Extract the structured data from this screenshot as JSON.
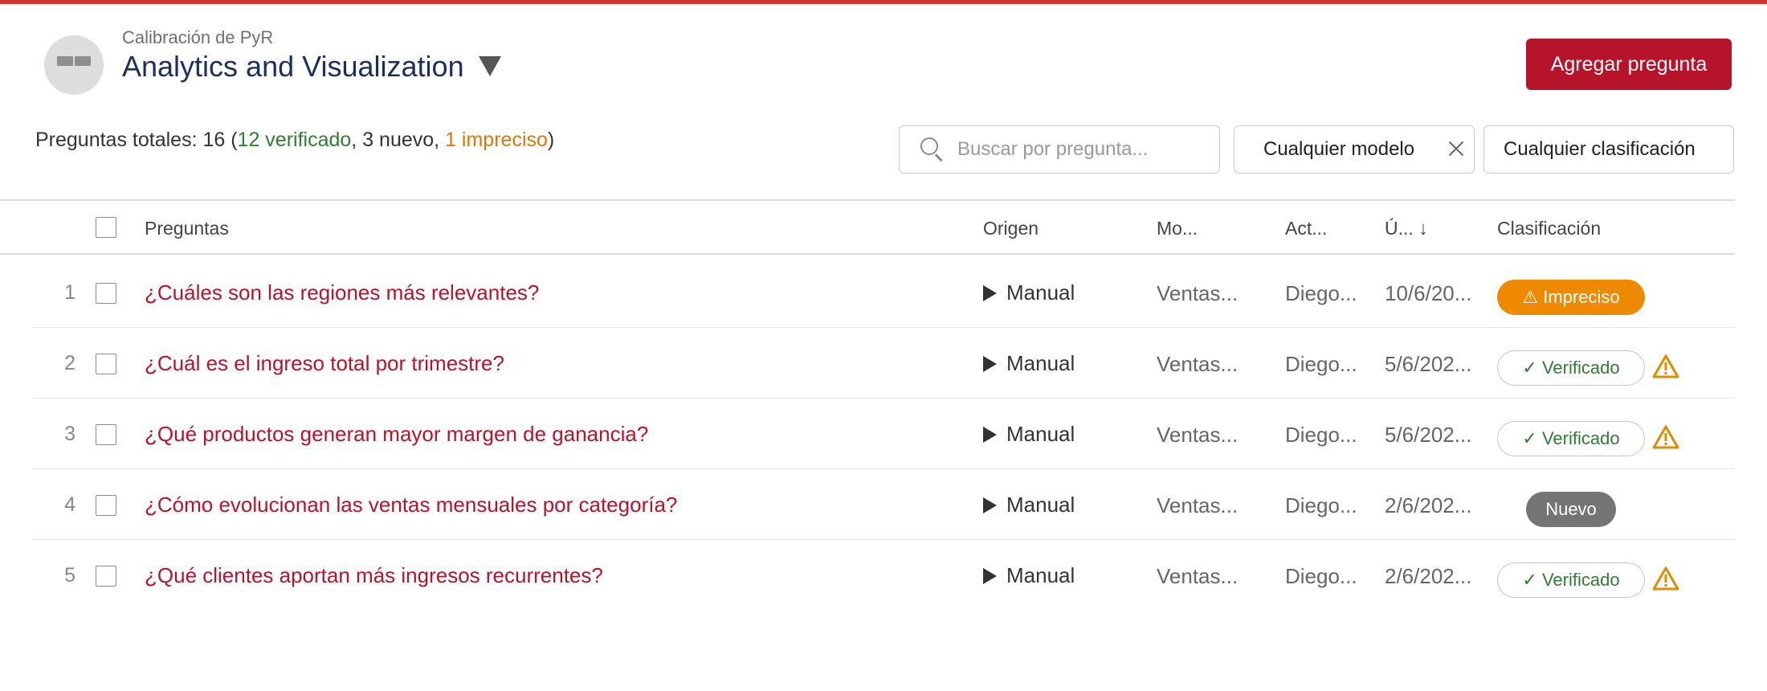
{
  "header": {
    "subtitle": "Calibración de PyR",
    "title": "Analytics and Visualization",
    "add_button": "Agregar pregunta"
  },
  "summary": {
    "prefix": "Preguntas totales: 16 (",
    "verified": "12 verificado",
    "sep1": ", ",
    "new": "3 nuevo",
    "sep2": ", ",
    "imprecise": "1 impreciso",
    "suffix": ")"
  },
  "filters": {
    "search_placeholder": "Buscar por pregunta...",
    "model": "Cualquier modelo",
    "classification": "Cualquier clasificación"
  },
  "columns": {
    "questions": "Preguntas",
    "origin": "Origen",
    "model": "Mo...",
    "actor": "Act...",
    "last": "Ú...",
    "sort_arrow": "↓",
    "classification": "Clasificación"
  },
  "rows": [
    {
      "num": "1",
      "question": "¿Cuáles son las regiones más relevantes?",
      "origin": "Manual",
      "model": "Ventas...",
      "actor": "Diego...",
      "date": "10/6/20...",
      "badge": "⚠ Impreciso",
      "status": "impreciso",
      "warning": false
    },
    {
      "num": "2",
      "question": "¿Cuál es el ingreso total por trimestre?",
      "origin": "Manual",
      "model": "Ventas...",
      "actor": "Diego...",
      "date": "5/6/202...",
      "badge": "✓ Verificado",
      "status": "verificado",
      "warning": true
    },
    {
      "num": "3",
      "question": "¿Qué productos generan mayor margen de ganancia?",
      "origin": "Manual",
      "model": "Ventas...",
      "actor": "Diego...",
      "date": "5/6/202...",
      "badge": "✓ Verificado",
      "status": "verificado",
      "warning": true
    },
    {
      "num": "4",
      "question": "¿Cómo evolucionan las ventas mensuales por categoría?",
      "origin": "Manual",
      "model": "Ventas...",
      "actor": "Diego...",
      "date": "2/6/202...",
      "badge": "Nuevo",
      "status": "nuevo",
      "warning": false
    },
    {
      "num": "5",
      "question": "¿Qué clientes aportan más ingresos recurrentes?",
      "origin": "Manual",
      "model": "Ventas...",
      "actor": "Diego...",
      "date": "2/6/202...",
      "badge": "✓ Verificado",
      "status": "verificado",
      "warning": true
    }
  ],
  "colors": {
    "accent": "#b5142b",
    "top_bar": "#d0342c",
    "title": "#1b2f5c",
    "verified": "#2e7d32",
    "imprecise": "#ee8a00",
    "new_badge": "#747474",
    "warning": "#e08a00"
  },
  "icons": {
    "avatar": "avatar-icon",
    "title_caret": "caret-down-icon",
    "search": "search-icon",
    "clear": "close-icon",
    "origin": "play-icon",
    "warning": "warning-icon"
  }
}
